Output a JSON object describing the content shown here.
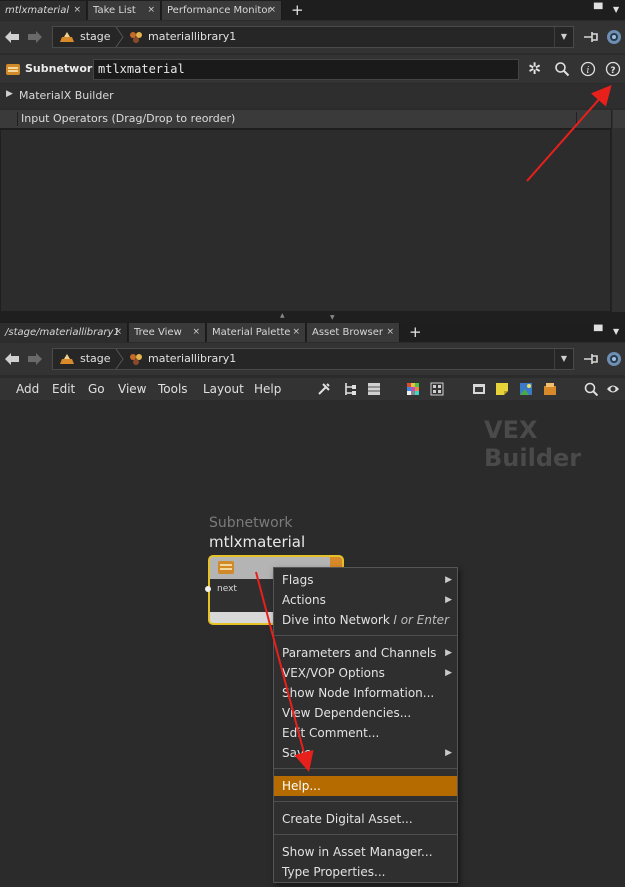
{
  "top_tabs": [
    "mtlxmaterial",
    "Take List",
    "Performance Monitor"
  ],
  "bottom_tabs": [
    "/stage/materiallibrary1",
    "Tree View",
    "Material Palette",
    "Asset Browser"
  ],
  "tab_close": "×",
  "plus": "+",
  "path_top": {
    "context": "stage",
    "node": "materiallibrary1"
  },
  "path_bottom": {
    "context": "stage",
    "node": "materiallibrary1"
  },
  "param_header": {
    "type_label": "Subnetwork",
    "node_name": "mtlxmaterial"
  },
  "materialx_section": "MaterialX Builder",
  "input_operators": "Input Operators (Drag/Drop to reorder)",
  "menubar": [
    "Add",
    "Edit",
    "Go",
    "View",
    "Tools",
    "Layout",
    "Help"
  ],
  "network": {
    "watermark": "VEX Builder",
    "node_type": "Subnetwork",
    "node_name": "mtlxmaterial",
    "port_label": "next"
  },
  "context_menu": {
    "items": [
      {
        "label": "Flags",
        "submenu": true
      },
      {
        "label": "Actions",
        "submenu": true
      },
      {
        "label": "Dive into Network",
        "shortcut": "I or Enter"
      },
      {
        "label": "Parameters and Channels",
        "submenu": true
      },
      {
        "label": "VEX/VOP Options",
        "submenu": true
      },
      {
        "label": "Show Node Information..."
      },
      {
        "label": "View Dependencies..."
      },
      {
        "label": "Edit Comment..."
      },
      {
        "label": "Save",
        "submenu": true
      },
      {
        "label": "Help...",
        "highlighted": true
      },
      {
        "label": "Create Digital Asset..."
      },
      {
        "label": "Show in Asset Manager..."
      },
      {
        "label": "Type Properties..."
      }
    ],
    "submenu_arrow": "▶"
  },
  "colors": {
    "accent": "#b66b00",
    "node_border": "#e6c229",
    "annotation": "#e8201c"
  },
  "icons": [
    "back-arrow-icon",
    "forward-arrow-icon",
    "pin-icon",
    "target-icon",
    "gear-icon",
    "search-icon",
    "info-icon",
    "help-icon"
  ]
}
